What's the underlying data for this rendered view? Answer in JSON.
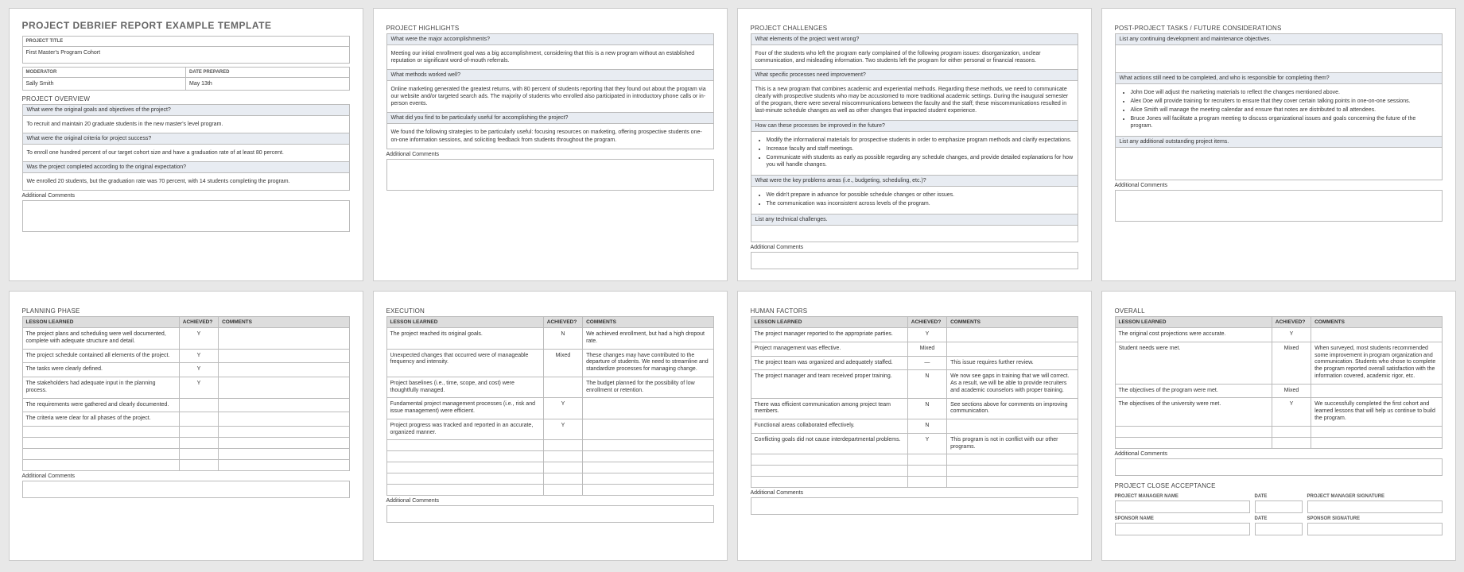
{
  "title": "PROJECT DEBRIEF REPORT EXAMPLE TEMPLATE",
  "meta": {
    "project_title_label": "PROJECT TITLE",
    "project_title": "First Master's Program Cohort",
    "moderator_label": "MODERATOR",
    "moderator": "Sally Smith",
    "date_label": "DATE PREPARED",
    "date": "May 13th"
  },
  "overview": {
    "heading": "PROJECT OVERVIEW",
    "q1": "What were the original goals and objectives of the project?",
    "a1": "To recruit and maintain 20 graduate students in the new master's level program.",
    "q2": "What were the original criteria for project success?",
    "a2": "To enroll one hundred percent of our target cohort size and have a graduation rate of at least 80 percent.",
    "q3": "Was the project completed according to the original expectation?",
    "a3": "We enrolled 20 students, but the graduation rate was 70 percent, with 14 students completing the program.",
    "additional_label": "Additional Comments"
  },
  "highlights": {
    "heading": "PROJECT HIGHLIGHTS",
    "q1": "What were the major accomplishments?",
    "a1": "Meeting our initial enrollment goal was a big accomplishment, considering that this is a new program without an established reputation or significant word-of-mouth referrals.",
    "q2": "What methods worked well?",
    "a2": "Online marketing generated the greatest returns, with 80 percent of students reporting that they found out about the program via our website and/or targeted search ads. The majority of students who enrolled also participated in introductory phone calls or in-person events.",
    "q3": "What did you find to be particularly useful for accomplishing the project?",
    "a3": "We found the following strategies to be particularly useful: focusing resources on marketing, offering prospective students one-on-one information sessions, and soliciting feedback from students throughout the program.",
    "additional_label": "Additional Comments"
  },
  "challenges": {
    "heading": "PROJECT CHALLENGES",
    "q1": "What elements of the project went wrong?",
    "a1": "Four of the students who left the program early complained of the following program issues: disorganization, unclear communication, and misleading information. Two students left the program for either personal or financial reasons.",
    "q2": "What specific processes need improvement?",
    "a2": "This is a new program that combines academic and experiential methods. Regarding these methods, we need to communicate clearly with prospective students who may be accustomed to more traditional academic settings. During the inaugural semester of the program, there were several miscommunications between the faculty and the staff; these miscommunications resulted in last-minute schedule changes as well as other changes that impacted student experience.",
    "q3": "How can these processes be improved in the future?",
    "a3_items": [
      "Modify the informational materials for prospective students in order to emphasize program methods and clarify expectations.",
      "Increase faculty and staff meetings.",
      "Communicate with students as early as possible regarding any schedule changes, and provide detailed explanations for how you will handle changes."
    ],
    "q4": "What were the key problems areas (i.e., budgeting, scheduling, etc.)?",
    "a4_items": [
      "We didn't prepare in advance for possible schedule changes or other issues.",
      "The communication was inconsistent across levels of the program."
    ],
    "q5": "List any technical challenges.",
    "additional_label": "Additional Comments"
  },
  "postproject": {
    "heading": "POST-PROJECT TASKS / FUTURE CONSIDERATIONS",
    "q1": "List any continuing development and maintenance objectives.",
    "q2": "What actions still need to be completed, and who is responsible for completing them?",
    "a2_items": [
      "John Doe will adjust the marketing materials to reflect the changes mentioned above.",
      "Alex Doe will provide training for recruiters to ensure that they cover certain talking points in one-on-one sessions.",
      "Alice Smith will manage the meeting calendar and ensure that notes are distributed to all attendees.",
      "Bruce Jones will facilitate a program meeting to discuss organizational issues and goals concerning the future of the program."
    ],
    "q3": "List any additional outstanding project items.",
    "additional_label": "Additional Comments"
  },
  "lessons_headers": {
    "c1": "LESSON LEARNED",
    "c2": "ACHIEVED?",
    "c3": "COMMENTS"
  },
  "planning": {
    "heading": "PLANNING PHASE",
    "rows": [
      {
        "lesson": "The project plans and scheduling were well documented, complete with adequate structure and detail.",
        "achieved": "Y",
        "comments": ""
      },
      {
        "lesson": "The project schedule contained all elements of the project.",
        "achieved": "Y",
        "comments": ""
      },
      {
        "lesson": "The tasks were clearly defined.",
        "achieved": "Y",
        "comments": ""
      },
      {
        "lesson": "The stakeholders had adequate input in the planning process.",
        "achieved": "Y",
        "comments": ""
      },
      {
        "lesson": "The requirements were gathered and clearly documented.",
        "achieved": "",
        "comments": ""
      },
      {
        "lesson": "The criteria were clear for all phases of the project.",
        "achieved": "",
        "comments": ""
      }
    ],
    "additional_label": "Additional Comments"
  },
  "execution": {
    "heading": "EXECUTION",
    "rows": [
      {
        "lesson": "The project reached its original goals.",
        "achieved": "N",
        "comments": "We achieved enrollment, but had a high dropout rate."
      },
      {
        "lesson": "Unexpected changes that occurred were of manageable frequency and intensity.",
        "achieved": "Mixed",
        "comments": "These changes may have contributed to the departure of students. We need to streamline and standardize processes for managing change."
      },
      {
        "lesson": "Project baselines (i.e., time, scope, and cost) were thoughtfully managed.",
        "achieved": "",
        "comments": "The budget planned for the possibility of low enrollment or retention."
      },
      {
        "lesson": "Fundamental project management processes (i.e., risk and issue management) were efficient.",
        "achieved": "Y",
        "comments": ""
      },
      {
        "lesson": "Project progress was tracked and reported in an accurate, organized manner.",
        "achieved": "Y",
        "comments": ""
      }
    ],
    "additional_label": "Additional Comments"
  },
  "human": {
    "heading": "HUMAN FACTORS",
    "rows": [
      {
        "lesson": "The project manager reported to the appropriate parties.",
        "achieved": "Y",
        "comments": ""
      },
      {
        "lesson": "Project management was effective.",
        "achieved": "Mixed",
        "comments": ""
      },
      {
        "lesson": "The project team was organized and adequately staffed.",
        "achieved": "—",
        "comments": "This issue requires further review."
      },
      {
        "lesson": "The project manager and team received proper training.",
        "achieved": "N",
        "comments": "We now see gaps in training that we will correct. As a result, we will be able to provide recruiters and academic counselors with proper training."
      },
      {
        "lesson": "There was efficient communication among project team members.",
        "achieved": "N",
        "comments": "See sections above for comments on improving communication."
      },
      {
        "lesson": "Functional areas collaborated effectively.",
        "achieved": "N",
        "comments": ""
      },
      {
        "lesson": "Conflicting goals did not cause interdepartmental problems.",
        "achieved": "Y",
        "comments": "This program is not in conflict with our other programs."
      }
    ],
    "additional_label": "Additional Comments"
  },
  "overall": {
    "heading": "OVERALL",
    "rows": [
      {
        "lesson": "The original cost projections were accurate.",
        "achieved": "Y",
        "comments": ""
      },
      {
        "lesson": "Student needs were met.",
        "achieved": "Mixed",
        "comments": "When surveyed, most students recommended some improvement in program organization and communication. Students who chose to complete the program reported overall satisfaction with the information covered, academic rigor, etc."
      },
      {
        "lesson": "The objectives of the program were met.",
        "achieved": "Mixed",
        "comments": ""
      },
      {
        "lesson": "The objectives of the university were met.",
        "achieved": "Y",
        "comments": "We successfully completed the first cohort and learned lessons that will help us continue to build the program."
      }
    ],
    "additional_label": "Additional Comments",
    "close_heading": "PROJECT CLOSE ACCEPTANCE",
    "pm_name": "PROJECT MANAGER NAME",
    "pm_sig": "PROJECT MANAGER SIGNATURE",
    "sponsor_name": "SPONSOR NAME",
    "sponsor_sig": "SPONSOR SIGNATURE",
    "date_label": "DATE"
  }
}
